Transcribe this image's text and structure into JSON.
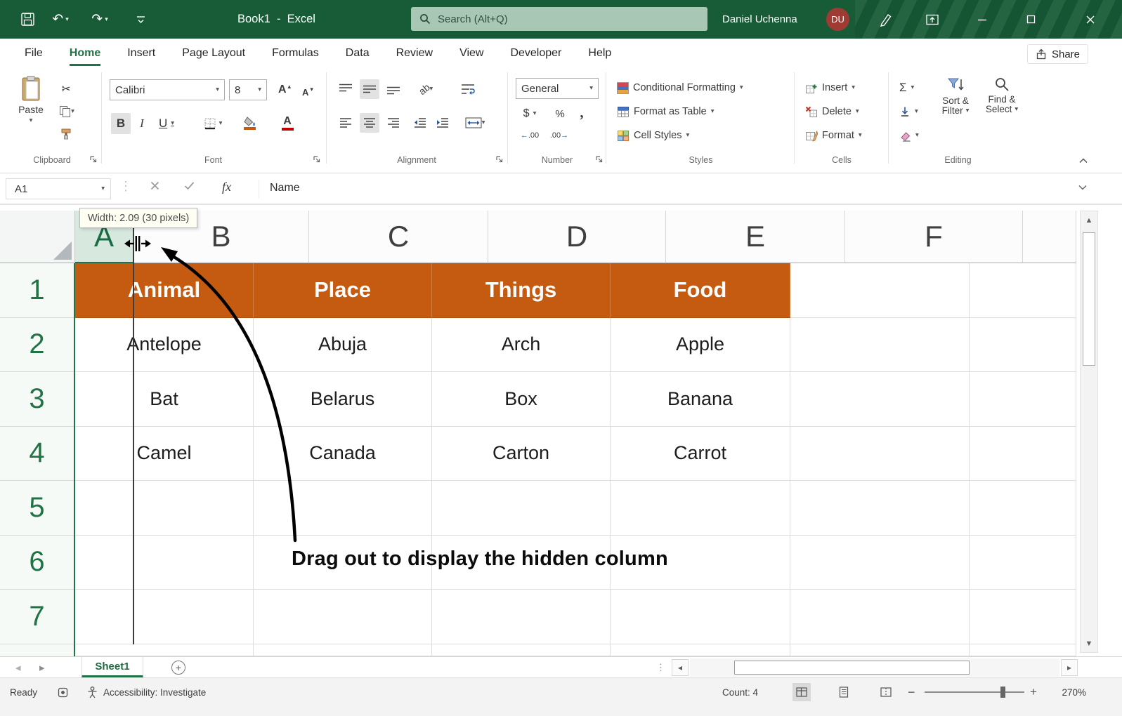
{
  "colors": {
    "accent": "#217346",
    "titlebar": "#185C37",
    "search": "#A9C7B5",
    "orange": "#C55A11",
    "avatar": "#9E3B33"
  },
  "title_bar": {
    "title": "Book1  -  Excel",
    "search_placeholder": "Search (Alt+Q)",
    "user_name": "Daniel Uchenna",
    "user_initials": "DU"
  },
  "tabs": {
    "items": [
      "File",
      "Home",
      "Insert",
      "Page Layout",
      "Formulas",
      "Data",
      "Review",
      "View",
      "Developer",
      "Help"
    ],
    "share": "Share"
  },
  "ribbon": {
    "clipboard": {
      "label": "Clipboard",
      "paste": "Paste"
    },
    "font": {
      "label": "Font",
      "family": "Calibri",
      "size": "8",
      "bold": "B",
      "italic": "I",
      "underline": "U",
      "grow": "A",
      "shrink": "A",
      "color_letter": "A"
    },
    "alignment": {
      "label": "Alignment",
      "orientation": "ab"
    },
    "number": {
      "label": "Number",
      "format": "General",
      "currency": "$",
      "percent": "%",
      "comma": ","
    },
    "styles": {
      "label": "Styles",
      "items": [
        "Conditional Formatting",
        "Format as Table",
        "Cell Styles"
      ]
    },
    "cells": {
      "label": "Cells",
      "items": [
        "Insert",
        "Delete",
        "Format"
      ]
    },
    "editing": {
      "label": "Editing",
      "autosum": "Σ",
      "sort_line1": "Sort &",
      "sort_line2": "Filter",
      "find_line1": "Find &",
      "find_line2": "Select"
    }
  },
  "formula_bar": {
    "name_box": "A1",
    "fx": "fx",
    "content": "Name"
  },
  "sheet": {
    "tooltip": "Width: 2.09 (30 pixels)",
    "annotation": "Drag out to display the hidden column",
    "columns": [
      "A",
      "B",
      "C",
      "D",
      "E",
      "F"
    ],
    "rows": [
      "1",
      "2",
      "3",
      "4",
      "5",
      "6",
      "7"
    ],
    "header_row": [
      "Animal",
      "Place",
      "Things",
      "Food"
    ],
    "data": [
      [
        "Antelope",
        "Abuja",
        "Arch",
        "Apple"
      ],
      [
        "Bat",
        "Belarus",
        "Box",
        "Banana"
      ],
      [
        "Camel",
        "Canada",
        "Carton",
        "Carrot"
      ]
    ]
  },
  "sheet_tabs": {
    "active": "Sheet1"
  },
  "status_bar": {
    "ready": "Ready",
    "accessibility": "Accessibility: Investigate",
    "count": "Count: 4",
    "zoom": "270%"
  }
}
